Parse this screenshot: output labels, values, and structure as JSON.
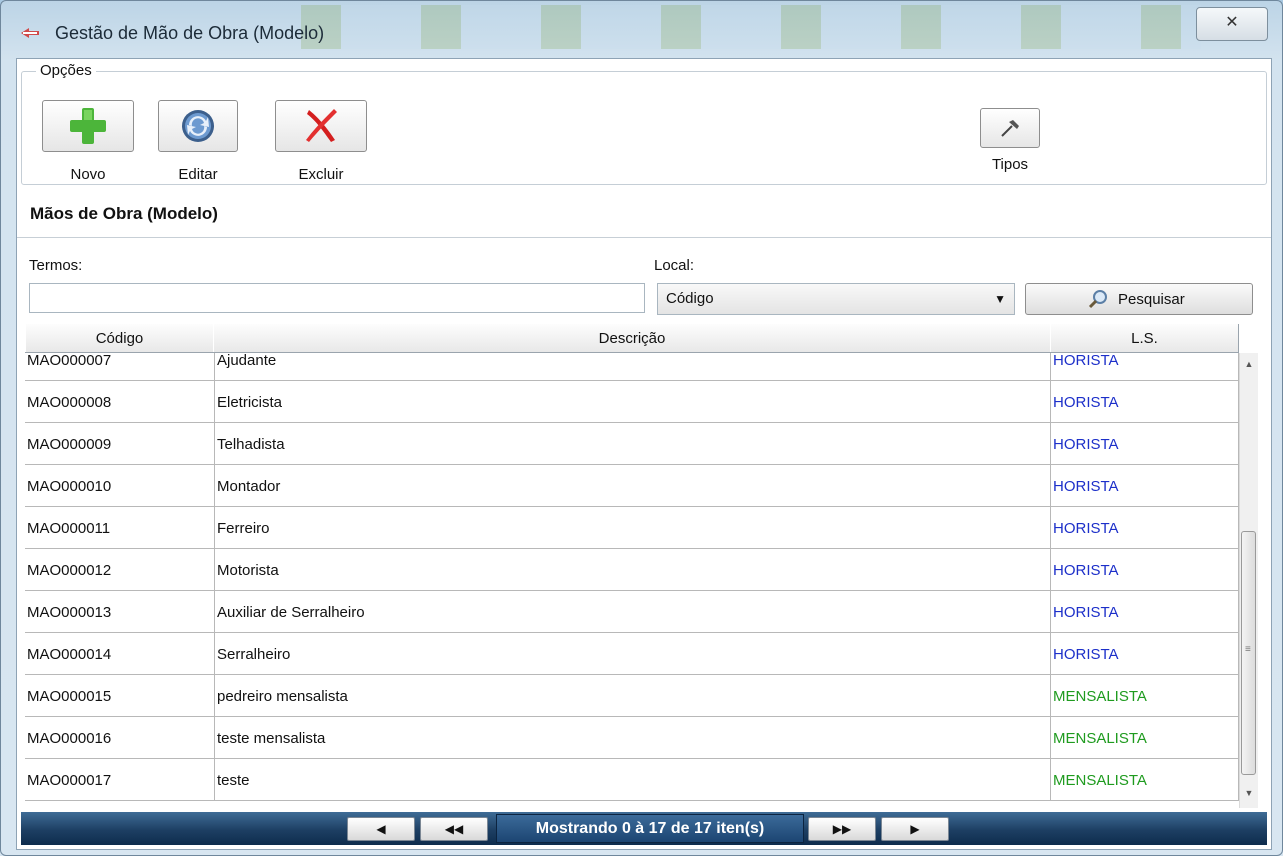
{
  "window": {
    "title": "Gestão de Mão de Obra (Modelo)",
    "close_label": "✕"
  },
  "options": {
    "legend": "Opções",
    "buttons": {
      "novo": "Novo",
      "editar": "Editar",
      "excluir": "Excluir",
      "tipos": "Tipos"
    }
  },
  "section": {
    "title": "Mãos de Obra (Modelo)"
  },
  "search": {
    "termos_label": "Termos:",
    "termos_value": "",
    "local_label": "Local:",
    "local_selected": "Código",
    "search_button": "Pesquisar"
  },
  "table": {
    "columns": [
      "Código",
      "Descrição",
      "L.S."
    ],
    "rows": [
      {
        "codigo": "MAO000007",
        "descricao": "Ajudante",
        "ls": "HORISTA"
      },
      {
        "codigo": "MAO000008",
        "descricao": "Eletricista",
        "ls": "HORISTA"
      },
      {
        "codigo": "MAO000009",
        "descricao": "Telhadista",
        "ls": "HORISTA"
      },
      {
        "codigo": "MAO000010",
        "descricao": "Montador",
        "ls": "HORISTA"
      },
      {
        "codigo": "MAO000011",
        "descricao": "Ferreiro",
        "ls": "HORISTA"
      },
      {
        "codigo": "MAO000012",
        "descricao": "Motorista",
        "ls": "HORISTA"
      },
      {
        "codigo": "MAO000013",
        "descricao": "Auxiliar de Serralheiro",
        "ls": "HORISTA"
      },
      {
        "codigo": "MAO000014",
        "descricao": "Serralheiro",
        "ls": "HORISTA"
      },
      {
        "codigo": "MAO000015",
        "descricao": "pedreiro mensalista",
        "ls": "MENSALISTA"
      },
      {
        "codigo": "MAO000016",
        "descricao": "teste mensalista",
        "ls": "MENSALISTA"
      },
      {
        "codigo": "MAO000017",
        "descricao": "teste",
        "ls": "MENSALISTA"
      }
    ]
  },
  "pager": {
    "info": "Mostrando 0 à 17 de 17 iten(s)",
    "prev_icon": "◀",
    "first_icon": "◀◀",
    "next_icon": "▶▶",
    "last_icon": "▶"
  },
  "colors": {
    "horista": "#1c2fc9",
    "mensalista": "#1f9b1f",
    "pager_bg": "#1d3f63"
  }
}
